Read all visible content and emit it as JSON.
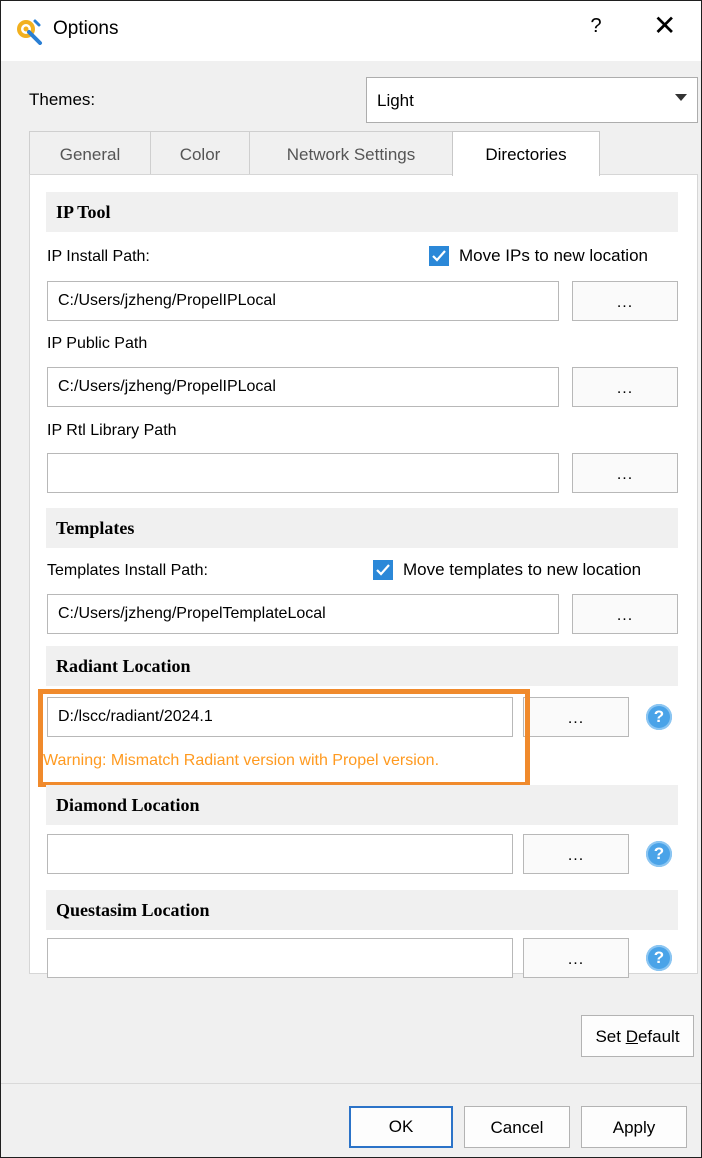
{
  "window": {
    "title": "Options",
    "help": "?",
    "close": "✕"
  },
  "themes": {
    "label": "Themes:",
    "value": "Light"
  },
  "tabs": [
    {
      "label": "General"
    },
    {
      "label": "Color"
    },
    {
      "label": "Network Settings"
    },
    {
      "label": "Directories"
    }
  ],
  "ip_tool": {
    "header": "IP Tool",
    "install_label": "IP Install Path:",
    "move_label": "Move IPs to new location",
    "move_checked": true,
    "install_value": "C:/Users/jzheng/PropelIPLocal",
    "public_label": "IP Public Path",
    "public_value": "C:/Users/jzheng/PropelIPLocal",
    "rtl_label": "IP Rtl Library Path",
    "rtl_value": ""
  },
  "templates": {
    "header": "Templates",
    "install_label": "Templates Install Path:",
    "move_label": "Move templates to new location",
    "move_checked": true,
    "install_value": "C:/Users/jzheng/PropelTemplateLocal"
  },
  "radiant": {
    "header": "Radiant Location",
    "value": "D:/lscc/radiant/2024.1",
    "warning": "Warning: Mismatch Radiant version with Propel version."
  },
  "diamond": {
    "header": "Diamond Location",
    "value": ""
  },
  "questasim": {
    "header": "Questasim Location",
    "value": ""
  },
  "browse_label": "...",
  "help_label": "?",
  "buttons": {
    "set_default_pre": "Set ",
    "set_default_u": "D",
    "set_default_post": "efault",
    "ok": "OK",
    "cancel": "Cancel",
    "apply": "Apply"
  },
  "colors": {
    "accent": "#2b88d8",
    "warning": "#ff9a20",
    "highlight": "#f08a2c"
  }
}
